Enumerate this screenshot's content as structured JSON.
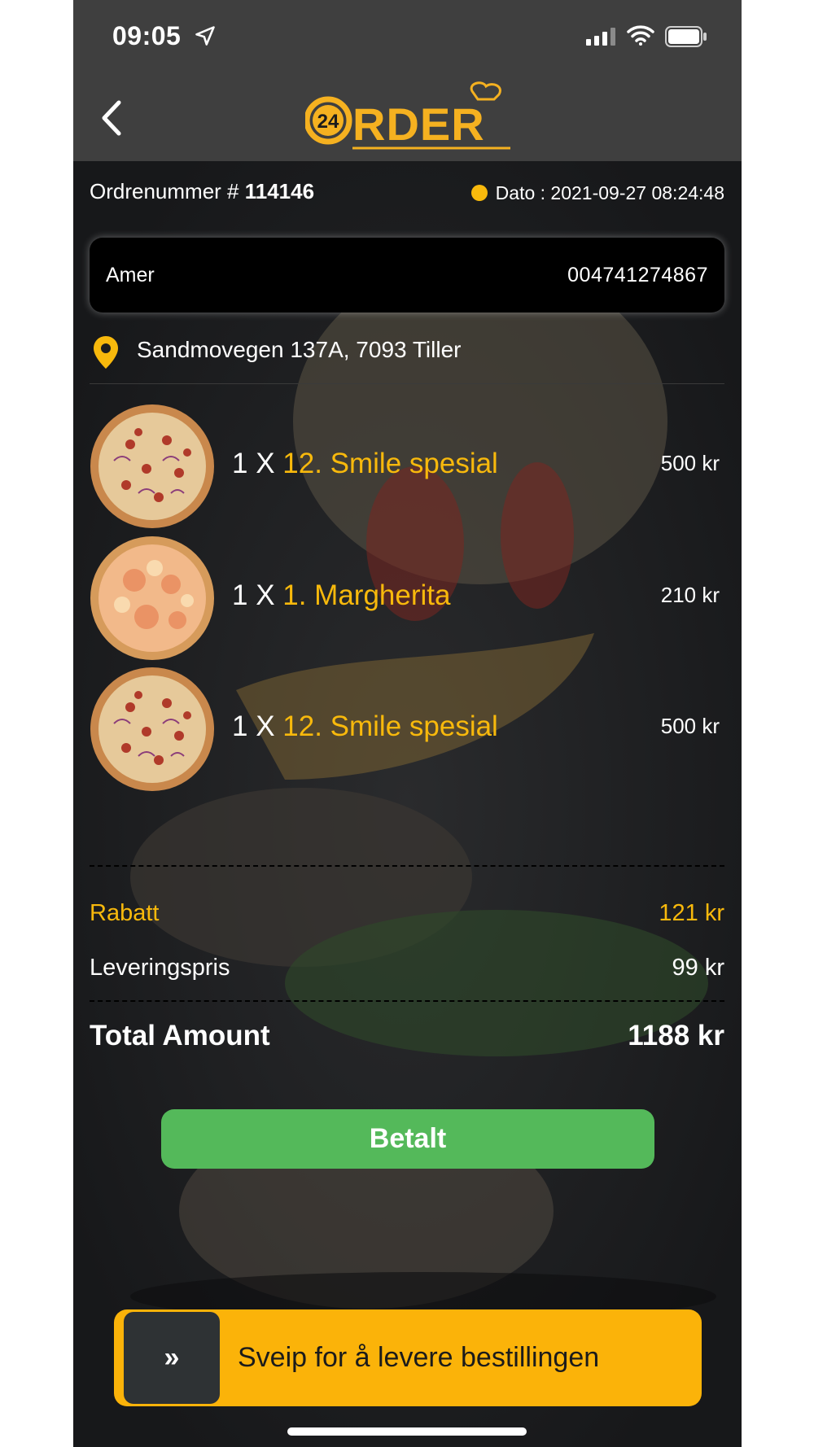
{
  "status_bar": {
    "time": "09:05"
  },
  "header": {
    "logo_badge": "24",
    "logo_text": "RDER"
  },
  "order": {
    "number_label": "Ordrenummer # ",
    "number": "114146",
    "date": "Dato : 2021-09-27 08:24:48",
    "status_color": "#f8b90c"
  },
  "customer": {
    "name": "Amer",
    "phone": "004741274867"
  },
  "address": "Sandmovegen 137A, 7093 Tiller",
  "items": [
    {
      "qty": "1 X ",
      "name": "12. Smile spesial",
      "price": "500 kr"
    },
    {
      "qty": "1 X ",
      "name": "1. Margherita",
      "price": "210 kr"
    },
    {
      "qty": "1 X ",
      "name": "12. Smile spesial",
      "price": "500 kr"
    }
  ],
  "summary": {
    "discount_label": "Rabatt",
    "discount_value": "121 kr",
    "delivery_label": "Leveringspris",
    "delivery_value": "99 kr",
    "total_label": "Total Amount",
    "total_value": "1188 kr"
  },
  "paid_button": "Betalt",
  "swipe": {
    "handle_icon": "»",
    "label": "Sveip for å levere bestillingen"
  },
  "colors": {
    "accent": "#f8b90c",
    "paid": "#54b95a",
    "swipe": "#fbb309",
    "bar": "#3f3f3f"
  }
}
